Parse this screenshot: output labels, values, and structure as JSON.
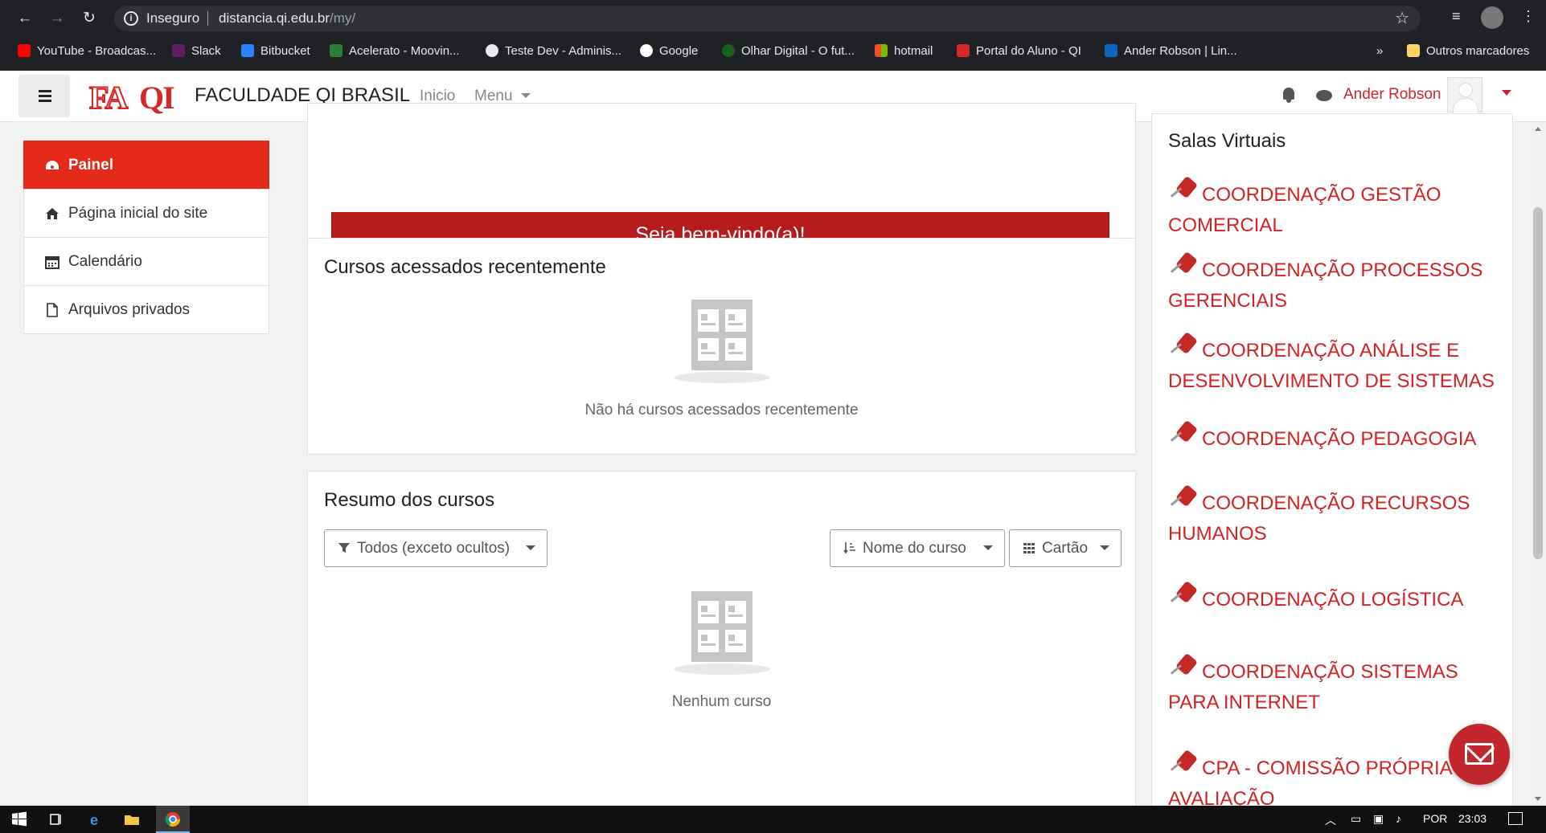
{
  "browser": {
    "insecure_label": "Inseguro",
    "url_host": "distancia.qi.edu.br",
    "url_path": "/my/",
    "bookmarks": [
      {
        "label": "YouTube - Broadcas...",
        "color": "#ff0000"
      },
      {
        "label": "Slack",
        "color": "#611f69"
      },
      {
        "label": "Bitbucket",
        "color": "#2684ff"
      },
      {
        "label": "Acelerato - Moovin...",
        "color": "#2e7d32"
      },
      {
        "label": "Teste Dev - Adminis...",
        "color": "#e8eaed"
      },
      {
        "label": "Google",
        "color": "#ffffff"
      },
      {
        "label": "Olhar Digital - O fut...",
        "color": "#1b5e20"
      },
      {
        "label": "hotmail",
        "color": "#f25022"
      },
      {
        "label": "Portal do Aluno - QI",
        "color": "#d62828"
      },
      {
        "label": "Ander Robson | Lin...",
        "color": "#0a66c2"
      }
    ],
    "more_label": "»",
    "other_bookmarks": "Outros marcadores"
  },
  "header": {
    "logo_fa": "FA",
    "logo_qi": "QI",
    "site_name": "FACULDADE QI BRASIL",
    "nav_inicio": "Inicio",
    "nav_menu": "Menu",
    "user_name": "Ander Robson"
  },
  "sidebar": {
    "items": [
      {
        "label": "Painel",
        "icon": "dashboard-icon"
      },
      {
        "label": "Página inicial do site",
        "icon": "home-icon"
      },
      {
        "label": "Calendário",
        "icon": "calendar-icon"
      },
      {
        "label": "Arquivos privados",
        "icon": "file-icon"
      }
    ]
  },
  "main": {
    "welcome": "Seja bem-vindo(a)!",
    "recent_title": "Cursos acessados recentemente",
    "recent_empty": "Não há cursos acessados recentemente",
    "overview_title": "Resumo dos cursos",
    "filter_label": "Todos (exceto ocultos)",
    "sort_label": "Nome do curso",
    "view_label": "Cartão",
    "overview_empty": "Nenhum curso"
  },
  "virtual_rooms": {
    "title": "Salas Virtuais",
    "items": [
      "COORDENAÇÃO GESTÃO COMERCIAL",
      "COORDENAÇÃO PROCESSOS GERENCIAIS",
      "COORDENAÇÃO ANÁLISE E DESENVOLVIMENTO DE SISTEMAS",
      "COORDENAÇÃO PEDAGOGIA",
      "COORDENAÇÃO RECURSOS HUMANOS",
      "COORDENAÇÃO LOGÍSTICA",
      "COORDENAÇÃO SISTEMAS PARA INTERNET",
      "CPA - COMISSÃO PRÓPRIA DE AVALIAÇÃO"
    ]
  },
  "taskbar": {
    "language": "POR",
    "time": "23:03"
  },
  "colors": {
    "brand_red": "#e62a1a",
    "welcome_red": "#b71c1c",
    "link_red": "#d32222"
  }
}
